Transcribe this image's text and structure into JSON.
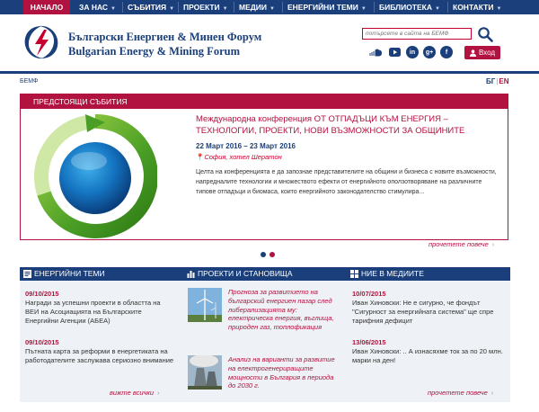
{
  "nav": {
    "items": [
      {
        "label": "НАЧАЛО"
      },
      {
        "label": "ЗА НАС"
      },
      {
        "label": "СЪБИТИЯ"
      },
      {
        "label": "ПРОЕКТИ"
      },
      {
        "label": "МЕДИИ"
      },
      {
        "label": "ЕНЕРГИЙНИ ТЕМИ"
      },
      {
        "label": "БИБЛИОТЕКА"
      },
      {
        "label": "КОНТАКТИ"
      }
    ]
  },
  "header": {
    "brand_bg": "Български Енергиен & Минен Форум",
    "brand_en": "Bulgarian Energy & Mining Forum",
    "search_placeholder": "потърсете в сайта на БЕМФ",
    "login_label": "Вход",
    "social_icons": [
      "soundcloud-icon",
      "youtube-icon",
      "linkedin-icon",
      "googleplus-icon",
      "facebook-icon"
    ]
  },
  "breadcrumb": "БЕМФ",
  "lang": {
    "bg": "БГ",
    "en": "EN"
  },
  "events": {
    "heading": "ПРЕДСТОЯЩИ СЪБИТИЯ",
    "title": "Международна конференция ОТ ОТПАДЪЦИ КЪМ ЕНЕРГИЯ – ТЕХНОЛОГИИ, ПРОЕКТИ, НОВИ ВЪЗМОЖНОСТИ ЗА ОБЩИНИТЕ",
    "date": "22 Март 2016 – 23 Март 2016",
    "place": "София, хотел Шератон",
    "description": "Целта на конференцията е да запознае представителите на общини и бизнеса с новите възможности, напредналите технологии и множеството ефекти от енергийното оползотворяване на различните типове отпадъци и биомаса, които енергийното законодателство стимулира...",
    "more": "прочетете повече"
  },
  "columns": {
    "energy": {
      "heading": "ЕНЕРГИЙНИ ТЕМИ",
      "items": [
        {
          "date": "09/10/2015",
          "text": "Награди за успешни проекти в областта на ВЕИ на Асоциацията на Българските Енергийни Агенции (АБЕА)"
        },
        {
          "date": "09/10/2015",
          "text": "Пътната карта за реформи в енергетиката на работодателите заслужава сериозно внимание"
        }
      ],
      "more": "вижте всички"
    },
    "projects": {
      "heading": "ПРОЕКТИ И СТАНОВИЩА",
      "items": [
        {
          "text": "Прогноза за развитието на българский енергиен пазар след либерализацията му: електрическа енергия, въглища, природен газ, топлофикация"
        },
        {
          "text": "Анализ на варианти за развитие на електрогенериращите мощности в България в периода до 2030 г."
        }
      ]
    },
    "media": {
      "heading": "НИЕ В МЕДИИТЕ",
      "items": [
        {
          "date": "10/07/2015",
          "text": "Иван Хиновски: Не е сигурно, че фондът \"Сигурност за енергийната система\" ще спре тарифния дефицит"
        },
        {
          "date": "13/06/2015",
          "text": "Иван Хиновски: .. А изнасяхме ток за по 20 млн. марки на ден!"
        }
      ],
      "more": "прочетете повече"
    }
  },
  "colors": {
    "navy": "#1b3f7a",
    "crimson": "#b2123f",
    "panel": "#eef1f5"
  }
}
